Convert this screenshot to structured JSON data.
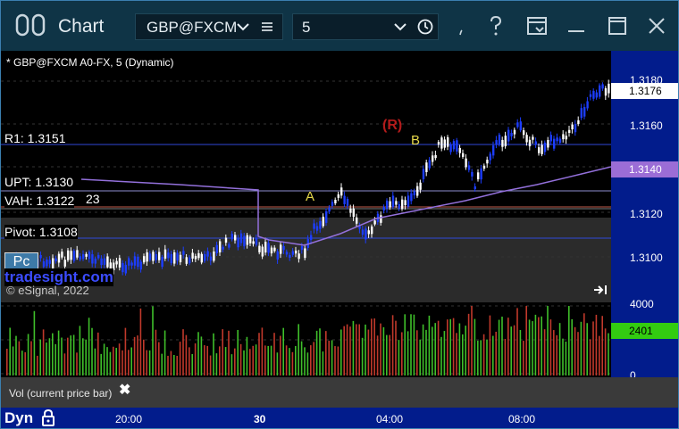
{
  "window": {
    "title": "Chart",
    "symbol": "GBP@FXCM",
    "interval": "5"
  },
  "chart": {
    "header": "* GBP@FXCM A0-FX, 5 (Dynamic)",
    "levels": {
      "r1": "R1: 1.3151",
      "upt": "UPT: 1.3130",
      "vah": "VAH: 1.3122",
      "vah_count": "23",
      "pivot": "Pivot: 1.3108"
    },
    "markers": {
      "a": "A",
      "b": "B",
      "r": "(R)"
    },
    "watermark": "tradesight.com",
    "copyright": "© eSignal, 2022",
    "pc_badge": "Pc",
    "price_ticks": [
      "1.3180",
      "1.3160",
      "1.3140",
      "1.3120",
      "1.3100"
    ],
    "last_price": "1.3176",
    "ma_price": "1.3140",
    "colors": {
      "up": "#ffffff",
      "down": "#1c3dff",
      "r1_line": "#2f49d8",
      "ma": "#9370db",
      "vah_line": "#c25b4c",
      "ma_badge": "#9b6dd6",
      "last_badge": "#ffffff"
    }
  },
  "volume": {
    "label": "Vol (current price bar)",
    "ticks": [
      "4000",
      "2401",
      "0"
    ],
    "current": "2401",
    "colors": {
      "up": "#3fbf2a",
      "down": "#c0392b",
      "badge": "#33cc11"
    }
  },
  "time_axis": {
    "lock_mode": "Dyn",
    "labels": [
      "20:00",
      "30",
      "04:00",
      "08:00"
    ]
  }
}
